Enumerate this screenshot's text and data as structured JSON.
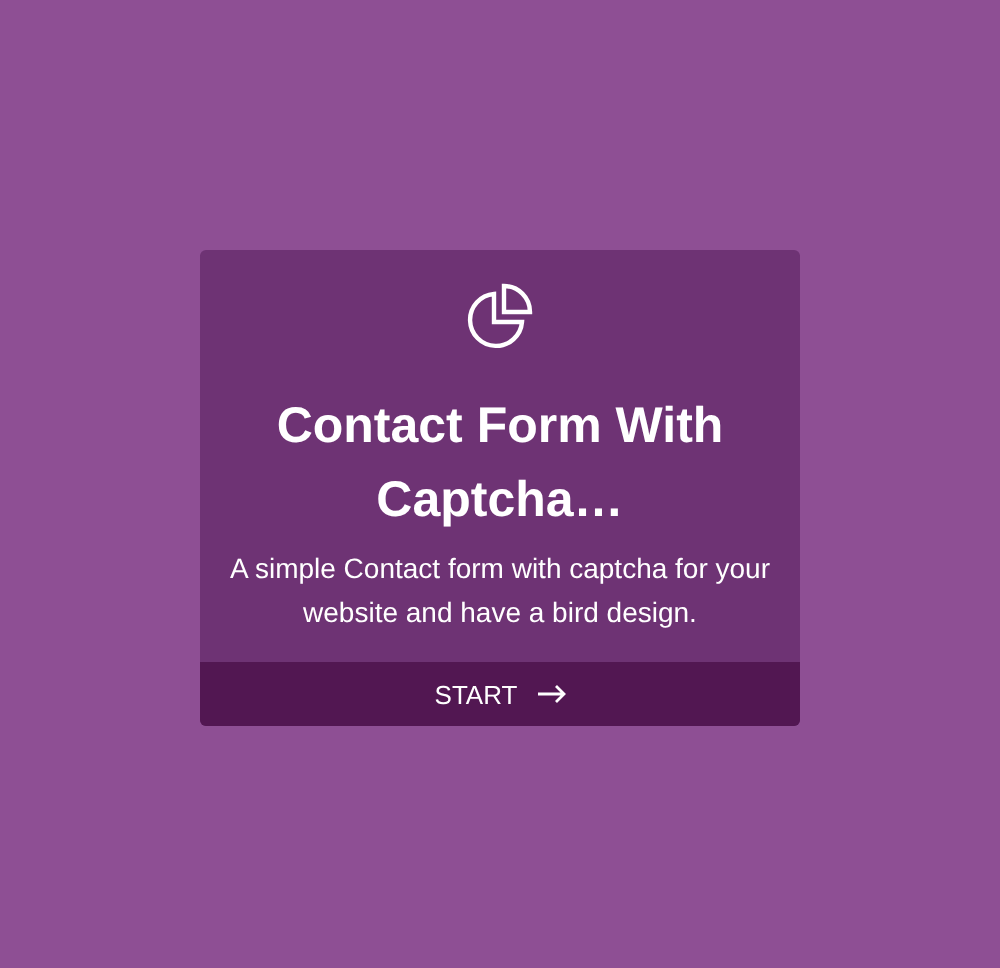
{
  "card": {
    "title": "Contact Form With Captcha…",
    "description": "A simple Contact form with captcha for your website and have a bird design.",
    "button": {
      "label": "START"
    }
  }
}
